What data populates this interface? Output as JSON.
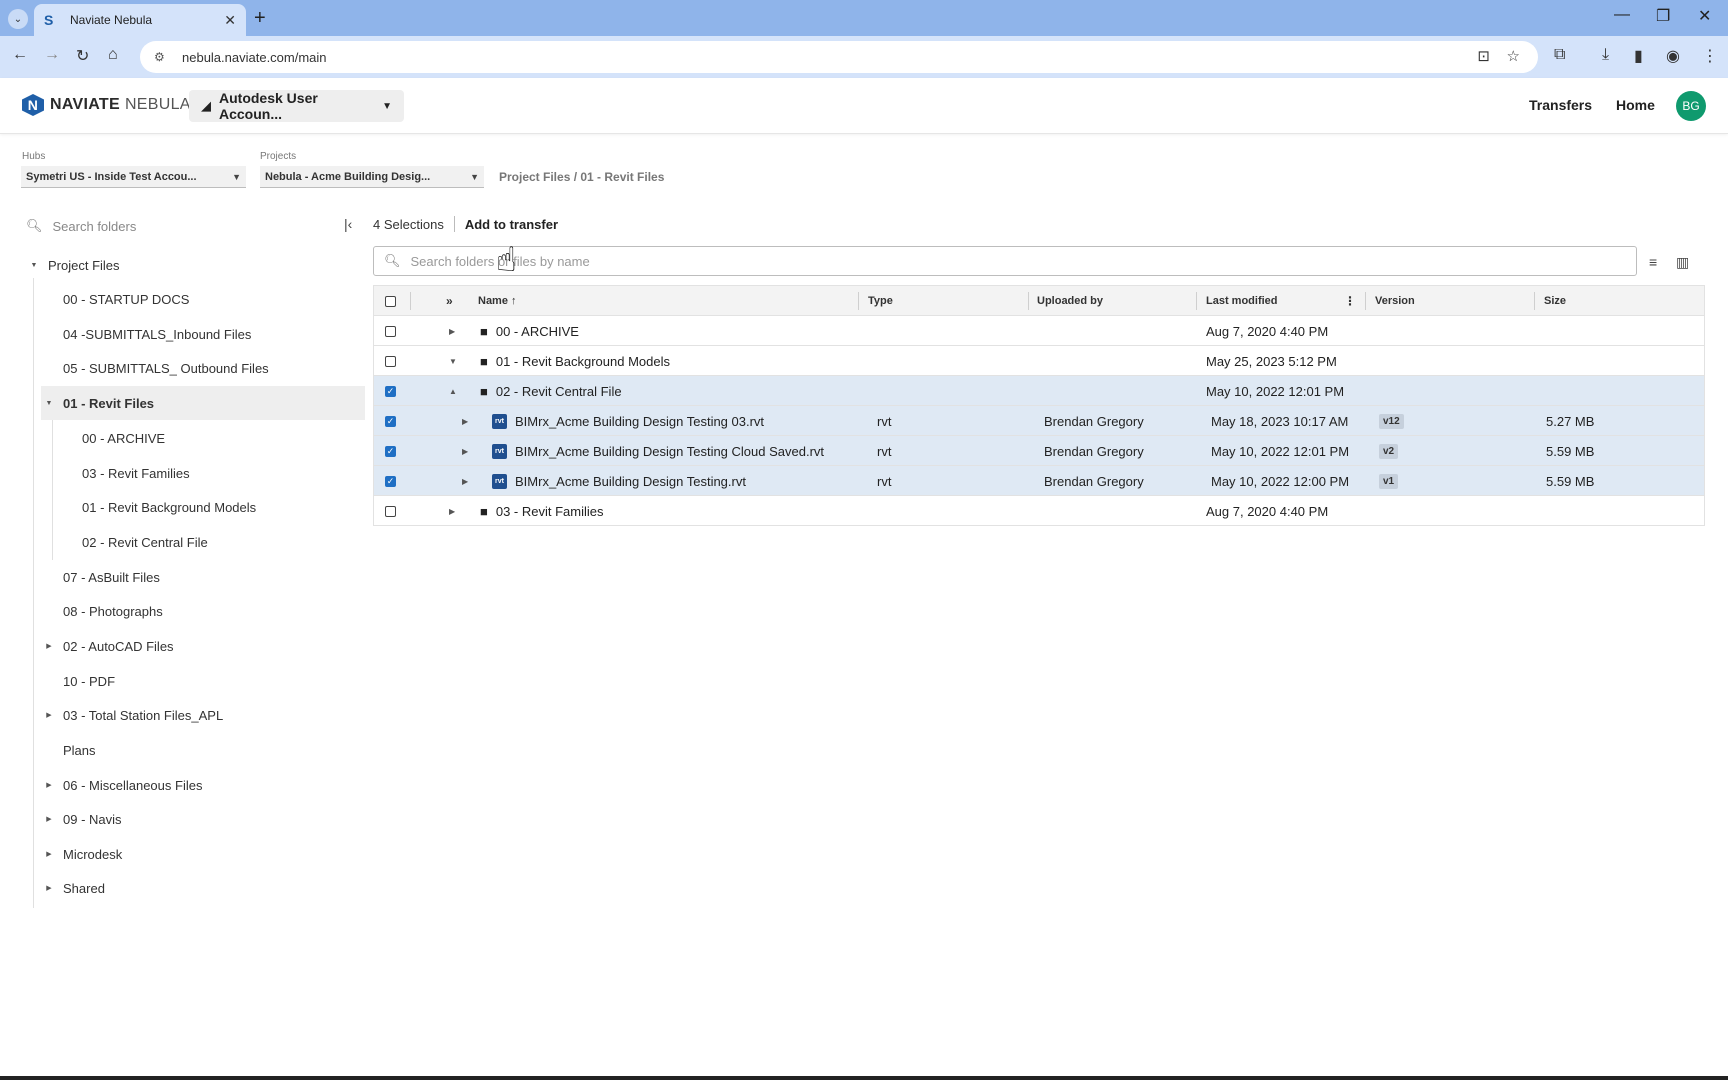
{
  "browser": {
    "tab_title": "Naviate Nebula",
    "url": "nebula.naviate.com/main"
  },
  "header": {
    "logo_bold": "NAVIATE",
    "logo_light": "NEBULA",
    "account_label": "Autodesk User Accoun...",
    "transfers_label": "Transfers",
    "home_label": "Home",
    "avatar_initials": "BG"
  },
  "selectors": {
    "hubs_label": "Hubs",
    "hubs_value": "Symetri US - Inside Test Accou...",
    "projects_label": "Projects",
    "projects_value": "Nebula - Acme Building Desig...",
    "breadcrumb": "Project Files  /  01 - Revit Files"
  },
  "tree": {
    "search_placeholder": "Search folders",
    "root": "Project Files",
    "items": [
      {
        "label": "00 - STARTUP DOCS"
      },
      {
        "label": "04 -SUBMITTALS_Inbound Files"
      },
      {
        "label": "05 - SUBMITTALS_ Outbound Files"
      },
      {
        "label": "01 - Revit Files"
      },
      {
        "label": "00 - ARCHIVE"
      },
      {
        "label": "03 - Revit Families"
      },
      {
        "label": "01 - Revit Background Models"
      },
      {
        "label": "02 - Revit Central File"
      },
      {
        "label": "07 - AsBuilt Files"
      },
      {
        "label": "08 - Photographs"
      },
      {
        "label": "02 - AutoCAD Files"
      },
      {
        "label": "10 - PDF"
      },
      {
        "label": "03 - Total Station Files_APL"
      },
      {
        "label": "Plans"
      },
      {
        "label": "06 - Miscellaneous Files"
      },
      {
        "label": "09 - Navis"
      },
      {
        "label": "Microdesk"
      },
      {
        "label": "Shared"
      }
    ]
  },
  "toolbar": {
    "selection_count": "4 Selections",
    "add_to_transfer": "Add to transfer",
    "search_placeholder": "Search folders or files by name"
  },
  "table": {
    "columns": {
      "name": "Name ↑",
      "type": "Type",
      "uploaded_by": "Uploaded by",
      "last_modified": "Last modified",
      "version": "Version",
      "size": "Size"
    },
    "rows": [
      {
        "name": "00 - ARCHIVE",
        "type": "",
        "uploaded_by": "",
        "modified": "Aug 7, 2020 4:40 PM",
        "version": "",
        "size": ""
      },
      {
        "name": "01 - Revit Background Models",
        "type": "",
        "uploaded_by": "",
        "modified": "May 25, 2023 5:12 PM",
        "version": "",
        "size": ""
      },
      {
        "name": "02 - Revit Central File",
        "type": "",
        "uploaded_by": "",
        "modified": "May 10, 2022 12:01 PM",
        "version": "",
        "size": ""
      },
      {
        "name": "BIMrx_Acme Building Design Testing 03.rvt",
        "type": "rvt",
        "uploaded_by": "Brendan Gregory",
        "modified": "May 18, 2023 10:17 AM",
        "version": "v12",
        "size": "5.27 MB"
      },
      {
        "name": "BIMrx_Acme Building Design Testing Cloud Saved.rvt",
        "type": "rvt",
        "uploaded_by": "Brendan Gregory",
        "modified": "May 10, 2022 12:01 PM",
        "version": "v2",
        "size": "5.59 MB"
      },
      {
        "name": "BIMrx_Acme Building Design Testing.rvt",
        "type": "rvt",
        "uploaded_by": "Brendan Gregory",
        "modified": "May 10, 2022 12:00 PM",
        "version": "v1",
        "size": "5.59 MB"
      },
      {
        "name": "03 - Revit Families",
        "type": "",
        "uploaded_by": "",
        "modified": "Aug 7, 2020 4:40 PM",
        "version": "",
        "size": ""
      }
    ]
  },
  "colors": {
    "accent": "#1f5fa8",
    "selected_row": "#dfe9f4",
    "avatar": "#0f9a6e"
  }
}
